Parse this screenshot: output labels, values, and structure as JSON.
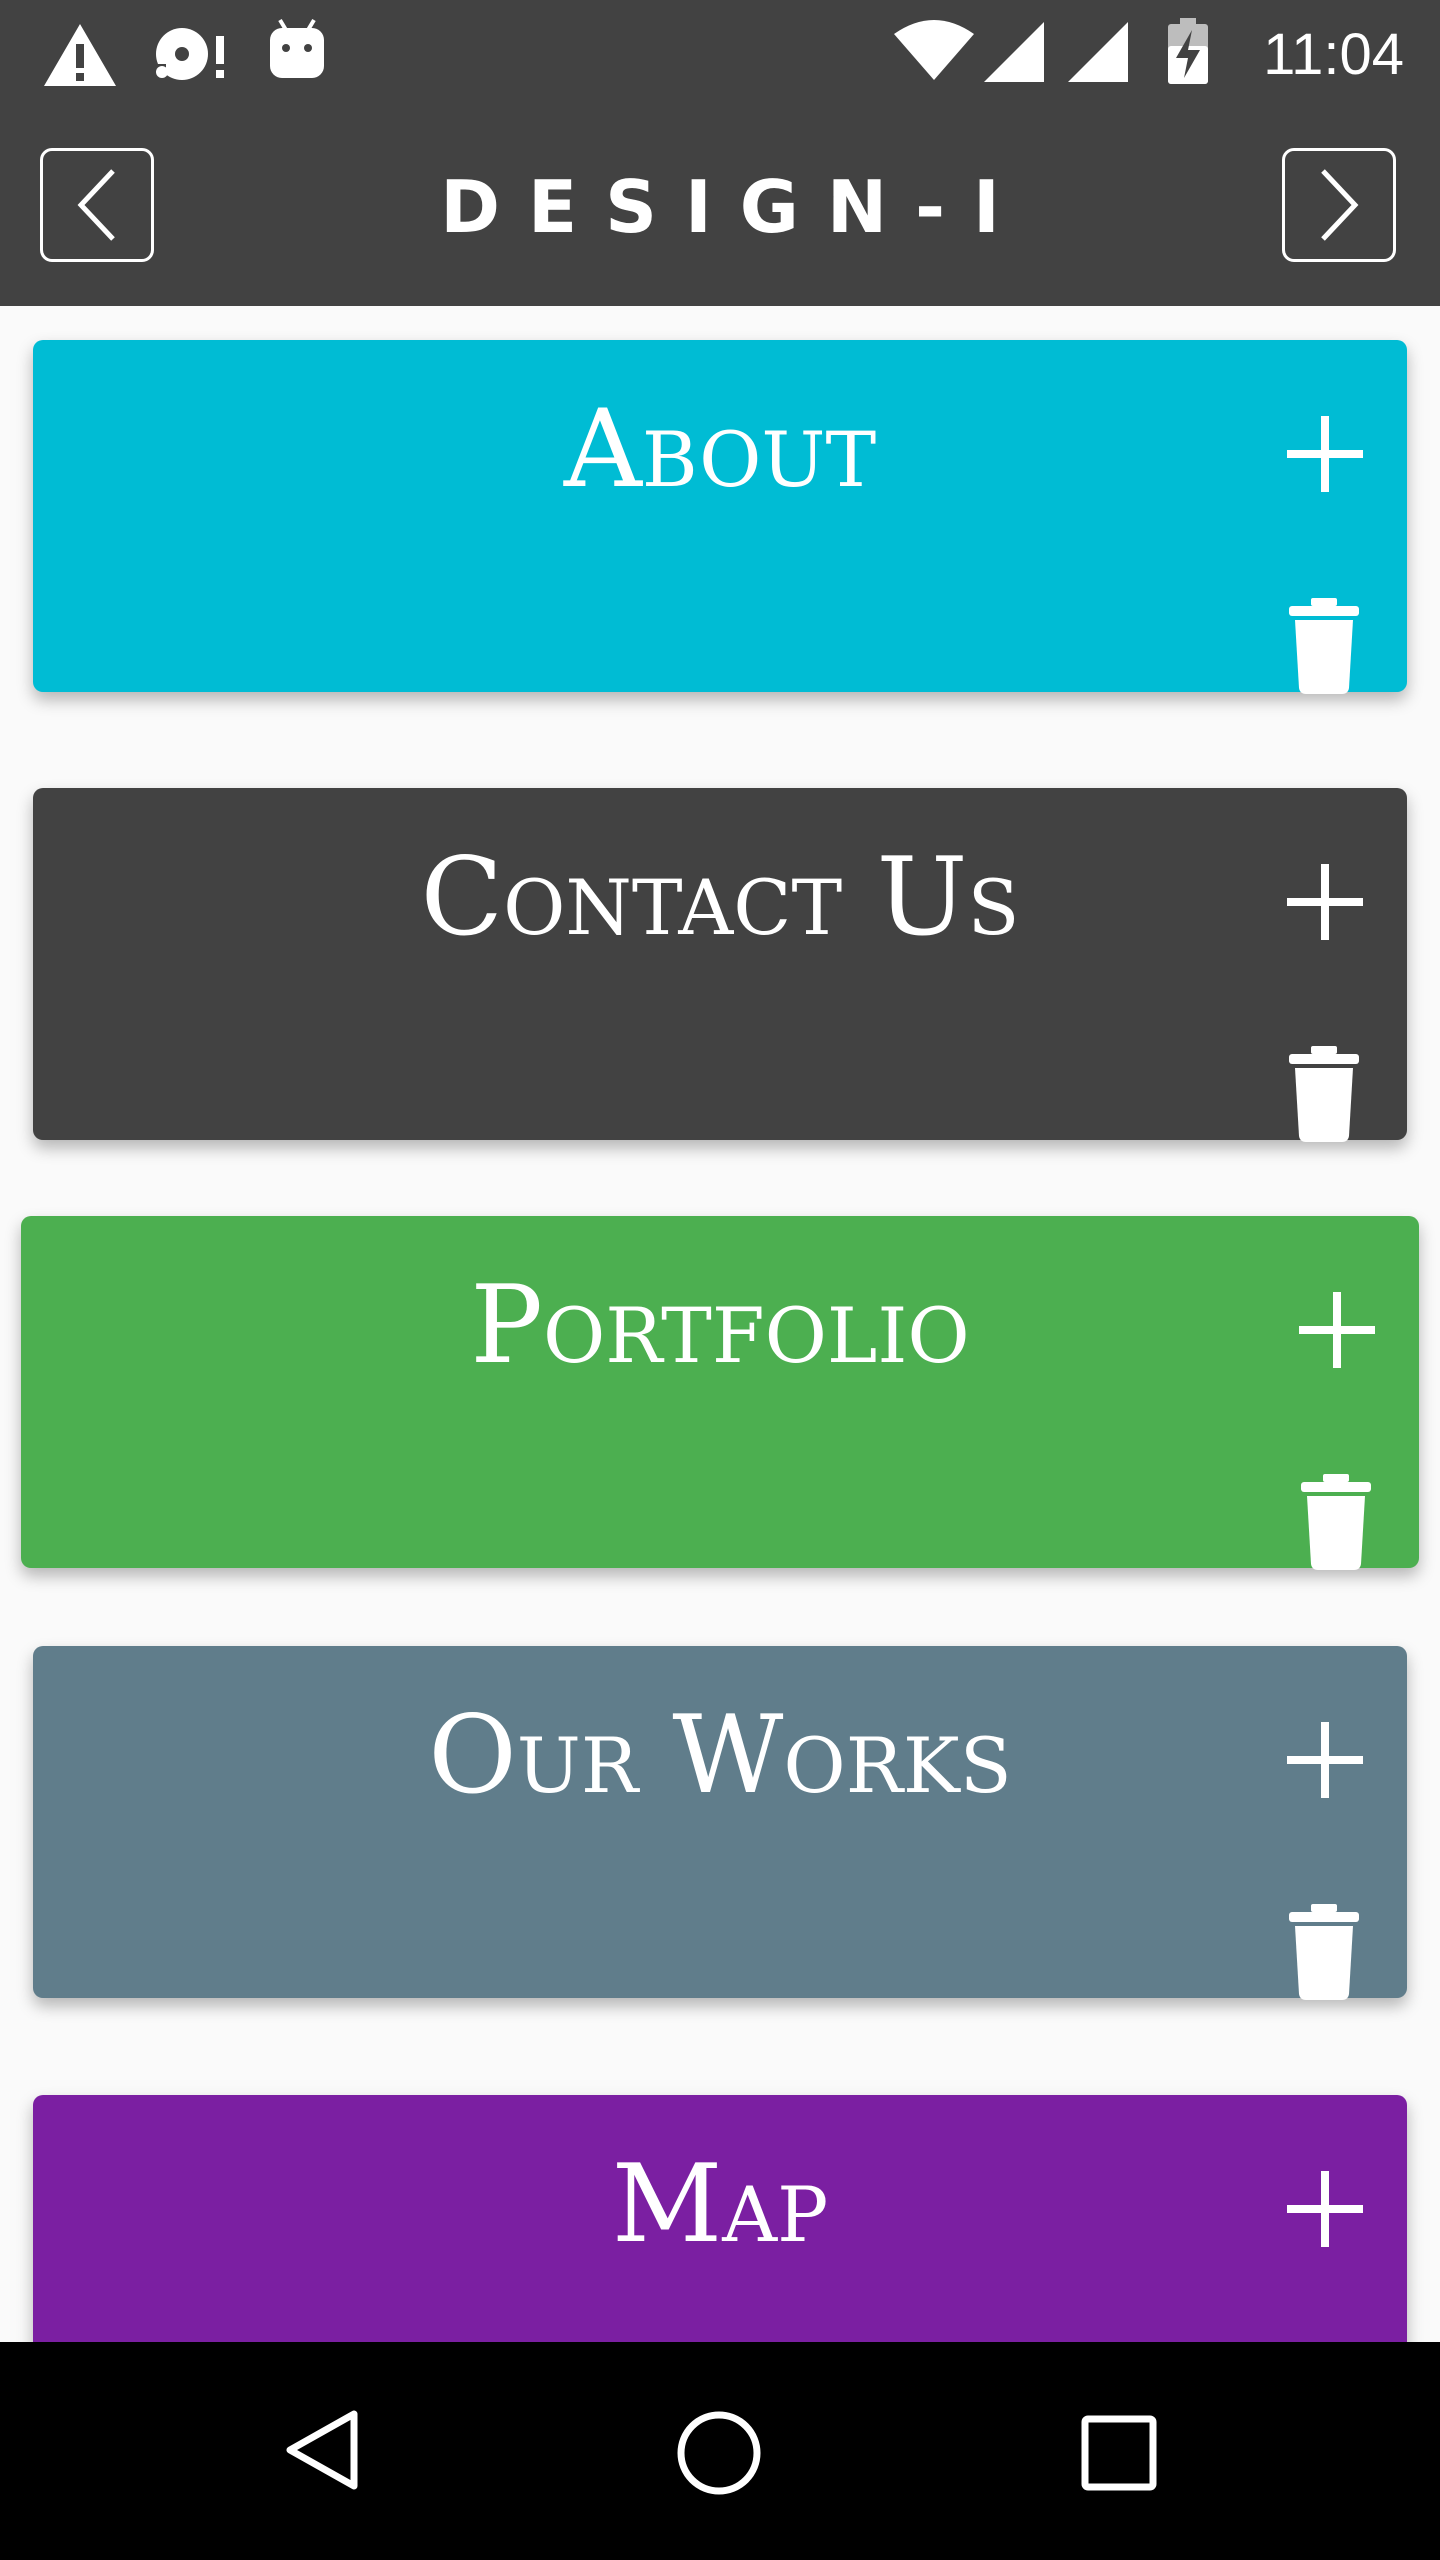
{
  "status_bar": {
    "time": "11:04",
    "left_icons": [
      "warning-icon",
      "disc-alert-icon",
      "android-icon"
    ],
    "right_icons": [
      "wifi-icon",
      "signal-icon",
      "signal-icon",
      "battery-charging-icon"
    ]
  },
  "toolbar": {
    "title": "DESIGN-I",
    "prev_icon": "chevron-left-icon",
    "next_icon": "chevron-right-icon",
    "background": "#424242"
  },
  "cards": [
    {
      "title": "About",
      "color": "#00bcd4"
    },
    {
      "title": "Contact Us",
      "color": "#424242"
    },
    {
      "title": "Portfolio",
      "color": "#4caf50"
    },
    {
      "title": "Our Works",
      "color": "#607d8b"
    },
    {
      "title": "Map",
      "color": "#7b1fa2"
    }
  ],
  "card_icons": {
    "add": "plus-icon",
    "delete": "trash-icon"
  },
  "nav_bar": {
    "icons": [
      "back-triangle-icon",
      "home-circle-icon",
      "recents-square-icon"
    ]
  }
}
